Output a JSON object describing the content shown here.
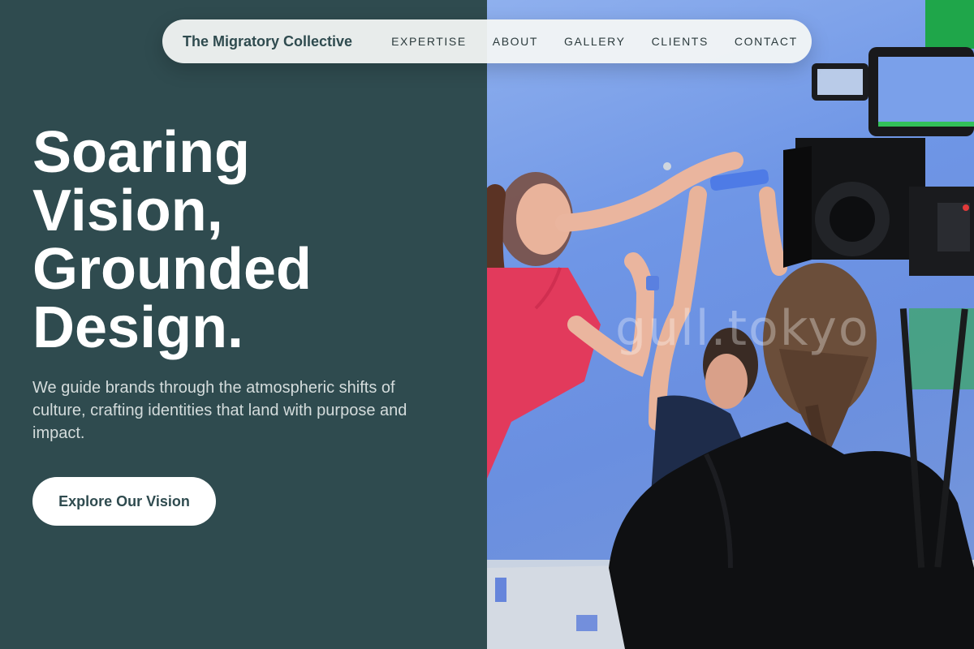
{
  "nav": {
    "brand": "The Migratory Collective",
    "links": [
      "EXPERTISE",
      "ABOUT",
      "GALLERY",
      "CLIENTS",
      "CONTACT"
    ]
  },
  "hero": {
    "headline_lines": [
      "Soaring",
      "Vision,",
      "Grounded",
      "Design."
    ],
    "subtext": "We guide brands through the atmospheric shifts of culture, crafting identities that land with purpose and impact.",
    "cta_label": "Explore Our Vision"
  },
  "photo": {
    "watermark": "gull.tokyo",
    "description_icon": "film-production-photo"
  },
  "colors": {
    "panel": "#2f4b4f",
    "nav_bg": "#f4f6f5",
    "headline": "#ffffff",
    "subtext": "#d4dcdc",
    "cta_bg": "#ffffff",
    "cta_text": "#2f4b4f",
    "backdrop_blue": "#6f96e6",
    "shirt_red": "#e23a5c"
  }
}
